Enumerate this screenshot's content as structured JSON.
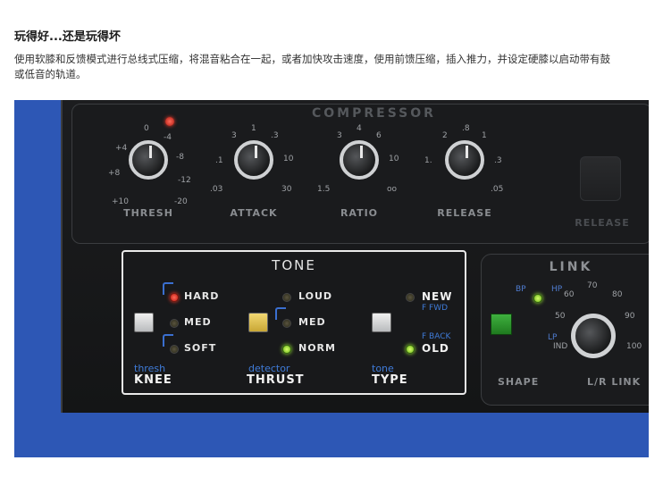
{
  "article": {
    "heading": "玩得好...还是玩得坏",
    "description": "使用软膝和反馈模式进行总线式压缩，将混音粘合在一起，或者加快攻击速度，使用前馈压缩，插入推力，并设定硬膝以启动带有鼓或低音的轨道。"
  },
  "plugin": {
    "compressor_title": "COMPRESSOR",
    "knobs": [
      {
        "label": "THRESH",
        "scale": [
          "0",
          "-4",
          "+4",
          "-8",
          "+8",
          "-12",
          "+10",
          "-20"
        ]
      },
      {
        "label": "ATTACK",
        "scale": [
          "3",
          "1",
          ".3",
          "10",
          ".1",
          "30",
          ".03"
        ]
      },
      {
        "label": "RATIO",
        "scale": [
          "3",
          "4",
          "6",
          "10",
          "1.5",
          "oo"
        ]
      },
      {
        "label": "RELEASE",
        "scale": [
          "2",
          ".8",
          "1",
          "1.",
          ".3",
          ".05"
        ]
      }
    ],
    "release_label": "RELEASE",
    "tone": {
      "title": "TONE",
      "knee": {
        "options": [
          "HARD",
          "MED",
          "SOFT"
        ],
        "sub": "thresh",
        "label": "KNEE"
      },
      "thrust": {
        "options": [
          "LOUD",
          "MED",
          "NORM"
        ],
        "sub": "detector",
        "label": "THRUST"
      },
      "type": {
        "new": "NEW",
        "new_sub": "F FWD",
        "old_sub": "F BACK",
        "old": "OLD",
        "sub": "tone",
        "label": "TYPE"
      }
    },
    "link": {
      "title": "LINK",
      "shape": "SHAPE",
      "lr_link": "L/R LINK",
      "small": [
        "BP",
        "HP",
        "LP"
      ],
      "scale": [
        "70",
        "60",
        "80",
        "50",
        "90",
        "IND",
        "100"
      ]
    }
  }
}
